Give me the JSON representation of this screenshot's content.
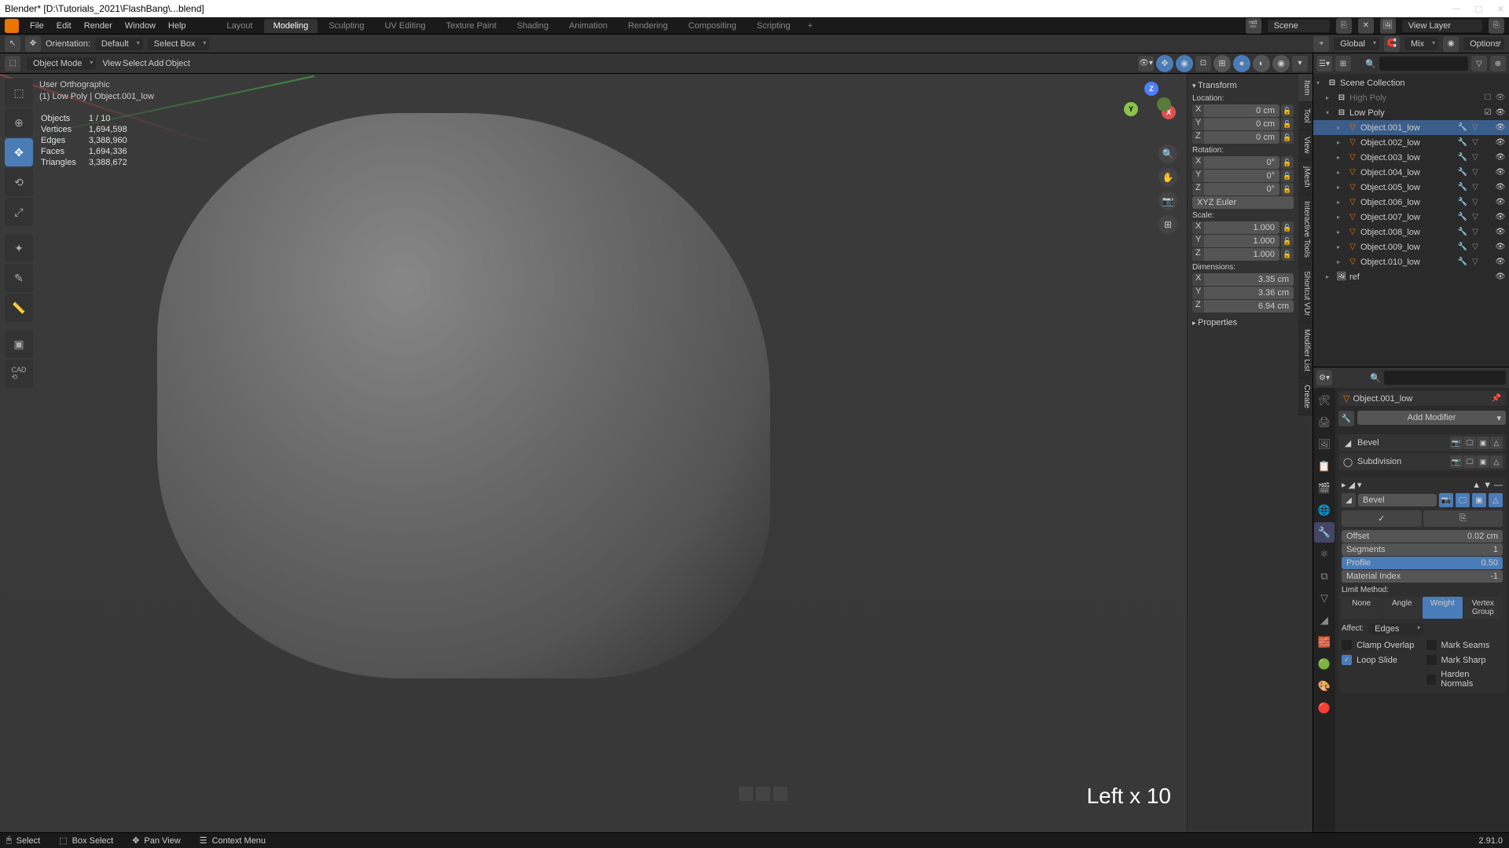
{
  "window": {
    "title": "Blender* [D:\\Tutorials_2021\\FlashBang\\...blend]",
    "min": "—",
    "max": "▢",
    "close": "✕"
  },
  "menu": {
    "items": [
      "File",
      "Edit",
      "Render",
      "Window",
      "Help"
    ],
    "tabs": [
      "Layout",
      "Modeling",
      "Sculpting",
      "UV Editing",
      "Texture Paint",
      "Shading",
      "Animation",
      "Rendering",
      "Compositing",
      "Scripting"
    ],
    "active_tab": 1,
    "scene_label": "Scene",
    "viewlayer_label": "View Layer"
  },
  "topbar": {
    "orientation_label": "Orientation:",
    "orientation_value": "Default",
    "select_mode": "Select Box",
    "transform_space": "Global",
    "snap_mode": "Mix",
    "options": "Options"
  },
  "vp_header": {
    "mode": "Object Mode",
    "menus": [
      "View",
      "Select",
      "Add",
      "Object"
    ]
  },
  "overlay": {
    "view": "User Orthographic",
    "context": "(1) Low Poly | Object.001_low",
    "stats": [
      [
        "Objects",
        "1 / 10"
      ],
      [
        "Vertices",
        "1,694,598"
      ],
      [
        "Edges",
        "3,388,960"
      ],
      [
        "Faces",
        "1,694,336"
      ],
      [
        "Triangles",
        "3,388,672"
      ]
    ]
  },
  "kb_hint": "Left x 10",
  "npanel": {
    "tabs": [
      "Item",
      "Tool",
      "View",
      "jMesh",
      "Interactive Tools",
      "Shortcut VUr",
      "Modifier List",
      "Create"
    ],
    "transform": {
      "title": "Transform",
      "location": "Location:",
      "rotation": "Rotation:",
      "scale": "Scale:",
      "dimensions": "Dimensions:",
      "loc": {
        "x": "0 cm",
        "y": "0 cm",
        "z": "0 cm"
      },
      "rot": {
        "x": "0°",
        "y": "0°",
        "z": "0°"
      },
      "rot_mode": "XYZ Euler",
      "scl": {
        "x": "1.000",
        "y": "1.000",
        "z": "1.000"
      },
      "dim": {
        "x": "3.35 cm",
        "y": "3.36 cm",
        "z": "6.94 cm"
      }
    },
    "properties_title": "Properties"
  },
  "outliner": {
    "root": "Scene Collection",
    "high_poly": "High Poly",
    "low_poly": "Low Poly",
    "objects": [
      "Object.001_low",
      "Object.002_low",
      "Object.003_low",
      "Object.004_low",
      "Object.005_low",
      "Object.006_low",
      "Object.007_low",
      "Object.008_low",
      "Object.009_low",
      "Object.010_low"
    ],
    "selected": 0,
    "ref": "ref"
  },
  "properties": {
    "breadcrumb": "Object.001_low",
    "add_modifier": "Add Modifier",
    "mods": [
      {
        "icon": "◢",
        "name": "Bevel"
      },
      {
        "icon": "◯",
        "name": "Subdivision"
      }
    ],
    "bevel": {
      "name": "Bevel",
      "offset_label": "Offset",
      "offset": "0.02 cm",
      "segments_label": "Segments",
      "segments": "1",
      "profile_label": "Profile",
      "profile": "0.50",
      "matidx_label": "Material Index",
      "matidx": "-1",
      "limit_label": "Limit Method:",
      "limit_opts": [
        "None",
        "Angle",
        "Weight",
        "Vertex Group"
      ],
      "limit_active": 2,
      "affect_label": "Affect:",
      "affect_value": "Edges",
      "checks": [
        {
          "label": "Clamp Overlap",
          "on": false
        },
        {
          "label": "Mark Seams",
          "on": false
        },
        {
          "label": "Loop Slide",
          "on": true
        },
        {
          "label": "Mark Sharp",
          "on": false
        },
        {
          "label": "",
          "on": false,
          "hidden": true
        },
        {
          "label": "Harden Normals",
          "on": false
        }
      ]
    }
  },
  "statusbar": {
    "items": [
      {
        "icon": "🖱",
        "label": "Select"
      },
      {
        "icon": "⬚",
        "label": "Box Select"
      },
      {
        "icon": "✥",
        "label": "Pan View"
      },
      {
        "icon": "☰",
        "label": "Context Menu"
      }
    ],
    "version": "2.91.0"
  }
}
